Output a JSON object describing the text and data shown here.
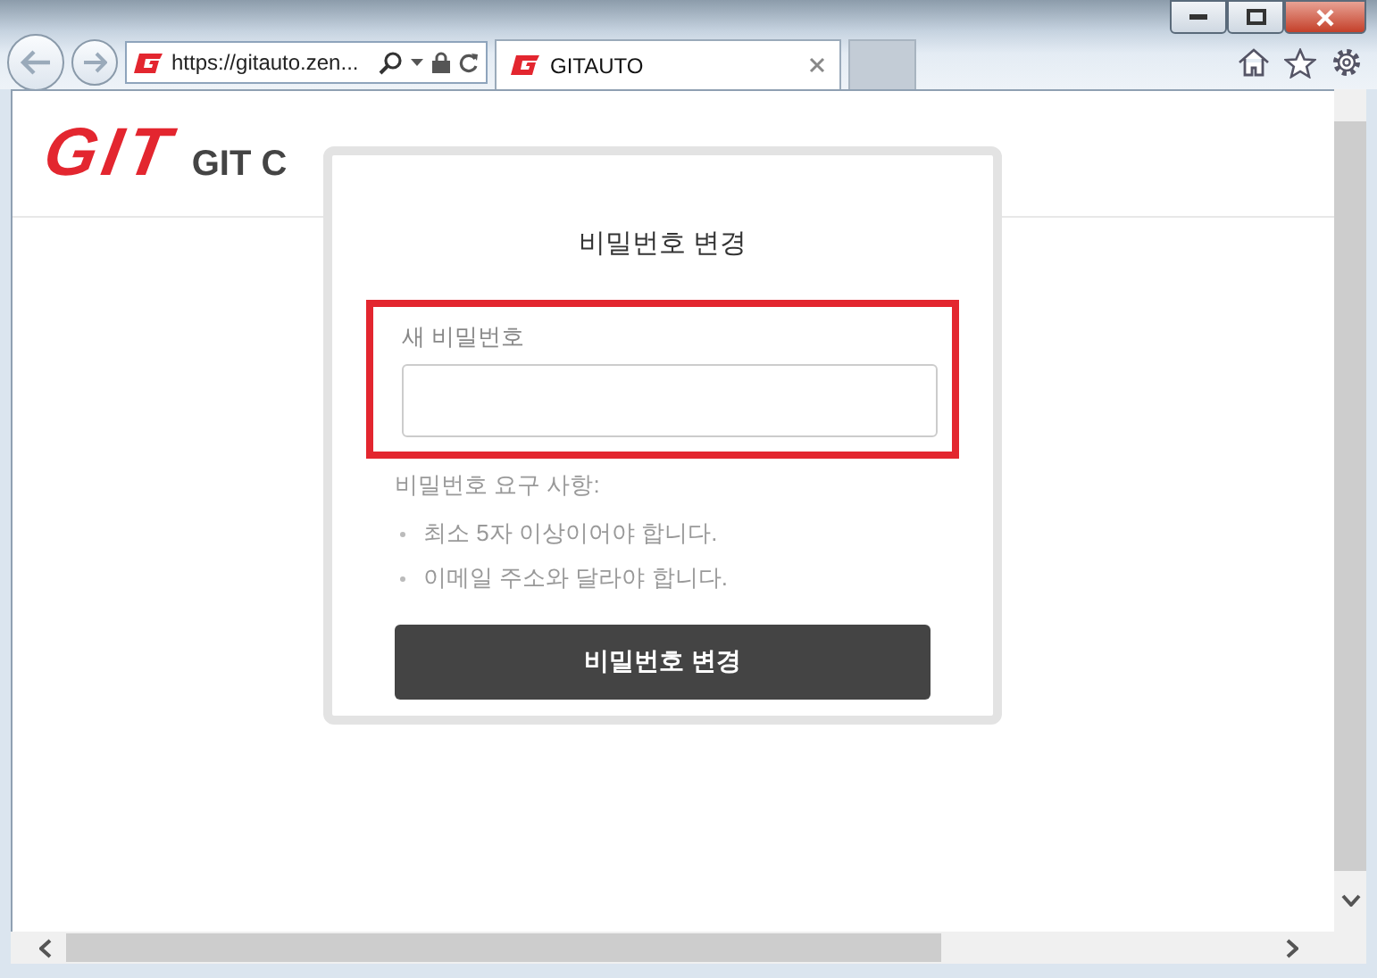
{
  "browser": {
    "address": "https://gitauto.zen...",
    "tabs": [
      {
        "title": "GITAUTO",
        "selected": true
      }
    ]
  },
  "site": {
    "logo": "GIT",
    "name": "GIT C"
  },
  "dialog": {
    "title": "비밀번호 변경",
    "field": {
      "label": "새 비밀번호",
      "highlighted": true
    },
    "requirements_title": "비밀번호 요구 사항:",
    "requirements": [
      "최소 5자 이상이어야 합니다.",
      "이메일 주소와 달라야 합니다."
    ],
    "submit": "비밀번호 변경"
  }
}
